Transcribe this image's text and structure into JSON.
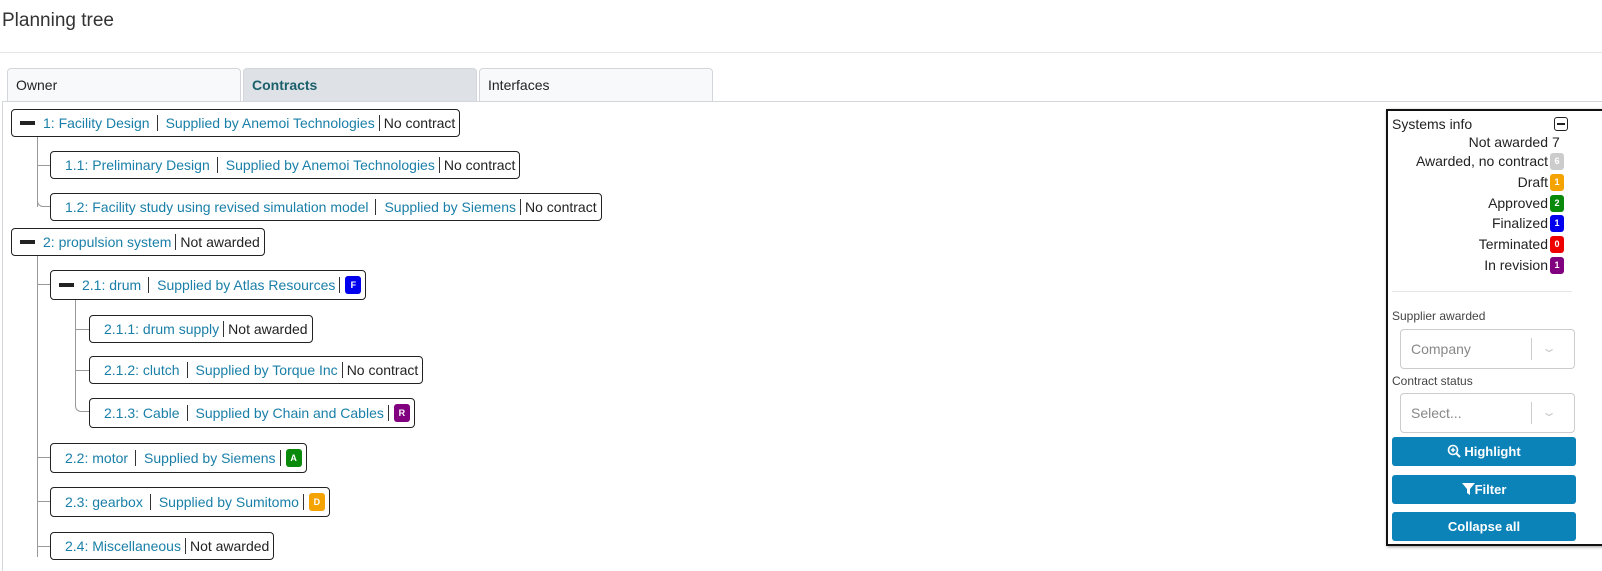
{
  "page": {
    "title": "Planning tree"
  },
  "tabs": [
    {
      "label": "Owner",
      "active": false
    },
    {
      "label": "Contracts",
      "active": true
    },
    {
      "label": "Interfaces",
      "active": false
    }
  ],
  "tree": {
    "n1": {
      "name": "1: Facility Design",
      "supplier": "Supplied by Anemoi Technologies",
      "status": "No contract"
    },
    "n1_1": {
      "name": "1.1: Preliminary Design",
      "supplier": "Supplied by Anemoi Technologies",
      "status": "No contract"
    },
    "n1_2": {
      "name": "1.2: Facility study using revised simulation model",
      "supplier": "Supplied by Siemens",
      "status": "No contract"
    },
    "n2": {
      "name": "2: propulsion system",
      "status": "Not awarded"
    },
    "n2_1": {
      "name": "2.1: drum",
      "supplier": "Supplied by Atlas Resources",
      "badge": "F"
    },
    "n2_1_1": {
      "name": "2.1.1: drum supply",
      "status": "Not awarded"
    },
    "n2_1_2": {
      "name": "2.1.2: clutch",
      "supplier": "Supplied by Torque Inc",
      "status": "No contract"
    },
    "n2_1_3": {
      "name": "2.1.3: Cable",
      "supplier": "Supplied by Chain and Cables",
      "badge": "R"
    },
    "n2_2": {
      "name": "2.2: motor",
      "supplier": "Supplied by Siemens",
      "badge": "A"
    },
    "n2_3": {
      "name": "2.3: gearbox",
      "supplier": "Supplied by Sumitomo",
      "badge": "D"
    },
    "n2_4": {
      "name": "2.4: Miscellaneous",
      "status": "Not awarded"
    }
  },
  "panel": {
    "title": "Systems info",
    "stats": [
      {
        "label": "Not awarded",
        "value": "7"
      },
      {
        "label": "Awarded, no contract",
        "value": "6"
      },
      {
        "label": "Draft",
        "value": "1"
      },
      {
        "label": "Approved",
        "value": "2"
      },
      {
        "label": "Finalized",
        "value": "1"
      },
      {
        "label": "Terminated",
        "value": "0"
      },
      {
        "label": "In revision",
        "value": "1"
      }
    ],
    "supplier_label": "Supplier awarded",
    "supplier_placeholder": "Company",
    "status_label": "Contract status",
    "status_placeholder": "Select...",
    "highlight_label": "Highlight",
    "filter_label": "Filter",
    "collapse_label": "Collapse all"
  },
  "colors": {
    "link": "#1a7fa8",
    "button": "#0b82b8",
    "awarded_no_contract": "#cccccc",
    "draft": "#f5a300",
    "approved": "#0a8a0a",
    "finalized": "#0000ee",
    "terminated": "#ee0000",
    "in_revision": "#800080"
  }
}
